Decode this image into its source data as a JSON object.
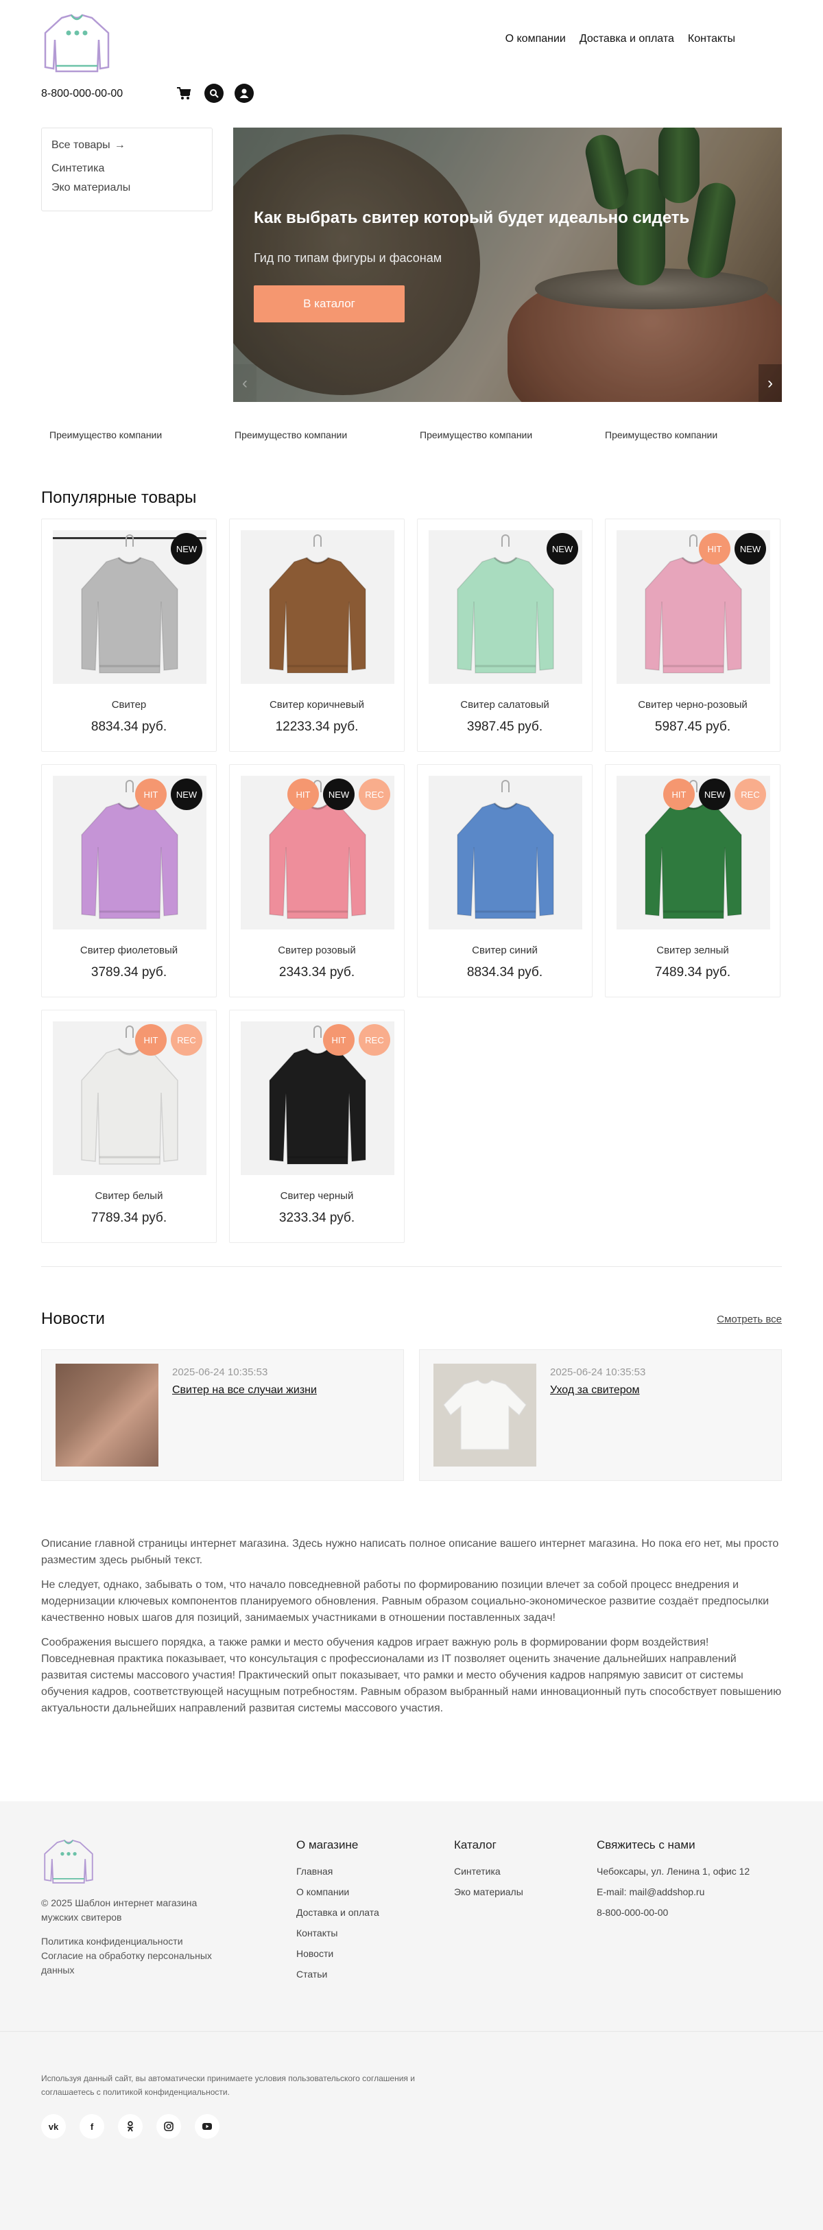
{
  "header": {
    "nav": [
      "О компании",
      "Доставка и оплата",
      "Контакты"
    ],
    "phone": "8-800-000-00-00",
    "icons": [
      "cart-icon",
      "search-icon",
      "user-icon"
    ]
  },
  "catalog_menu": {
    "all": "Все товары",
    "items": [
      "Синтетика",
      "Эко материалы"
    ]
  },
  "slider": {
    "title": "Как выбрать свитер который будет идеально сидеть",
    "subtitle": "Гид по типам фигуры и фасонам",
    "button": "В каталог"
  },
  "advantages": [
    "Преимущество компании",
    "Преимущество компании",
    "Преимущество компании",
    "Преимущество компании"
  ],
  "popular": {
    "title": "Популярные товары",
    "products": [
      {
        "name": "Свитер",
        "price": "8834.34 руб.",
        "badges": [
          "NEW"
        ],
        "color": "#b8b8b8"
      },
      {
        "name": "Свитер коричневый",
        "price": "12233.34 руб.",
        "badges": [],
        "color": "#8a5a34"
      },
      {
        "name": "Свитер салатовый",
        "price": "3987.45 руб.",
        "badges": [
          "NEW"
        ],
        "color": "#a9dcbf"
      },
      {
        "name": "Свитер черно-розовый",
        "price": "5987.45 руб.",
        "badges": [
          "HIT",
          "NEW"
        ],
        "color": "#e7a5bb"
      },
      {
        "name": "Свитер фиолетовый",
        "price": "3789.34 руб.",
        "badges": [
          "HIT",
          "NEW"
        ],
        "color": "#c594d6"
      },
      {
        "name": "Свитер розовый",
        "price": "2343.34 руб.",
        "badges": [
          "HIT",
          "NEW",
          "REC"
        ],
        "color": "#ee8e9b"
      },
      {
        "name": "Свитер синий",
        "price": "8834.34 руб.",
        "badges": [],
        "color": "#5a88c8"
      },
      {
        "name": "Свитер зелный",
        "price": "7489.34 руб.",
        "badges": [
          "HIT",
          "NEW",
          "REC"
        ],
        "color": "#2f7a3e"
      },
      {
        "name": "Свитер белый",
        "price": "7789.34 руб.",
        "badges": [
          "HIT",
          "REC"
        ],
        "color": "#ececea"
      },
      {
        "name": "Свитер черный",
        "price": "3233.34 руб.",
        "badges": [
          "HIT",
          "REC"
        ],
        "color": "#1c1c1c"
      }
    ]
  },
  "news": {
    "title": "Новости",
    "see_all": "Смотреть все",
    "items": [
      {
        "date": "2025-06-24 10:35:53",
        "title": "Свитер на все случаи жизни"
      },
      {
        "date": "2025-06-24 10:35:53",
        "title": "Уход за свитером"
      }
    ]
  },
  "description": [
    "Описание главной страницы интернет магазина. Здесь нужно написать полное описание вашего интернет магазина. Но пока его нет, мы просто разместим здесь рыбный текст.",
    "Не следует, однако, забывать о том, что начало повседневной работы по формированию позиции влечет за собой процесс внедрения и модернизации ключевых компонентов планируемого обновления. Равным образом социально-экономическое развитие создаёт предпосылки качественно новых шагов для позиций, занимаемых участниками в отношении поставленных задач!",
    "Соображения высшего порядка, а также рамки и место обучения кадров играет важную роль в формировании форм воздействия! Повседневная практика показывает, что консультация с профессионалами из IT позволяет оценить значение дальнейших направлений развитая системы массового участия! Практический опыт показывает, что рамки и место обучения кадров напрямую зависит от системы обучения кадров, соответствующей насущным потребностям. Равным образом выбранный нами инновационный путь способствует повышению актуальности дальнейших направлений развитая системы массового участия."
  ],
  "footer": {
    "copyright": "© 2025 Шаблон интернет магазина мужских свитеров",
    "policy": "Политика конфиденциальности",
    "consent": "Согласие на обработку персональных данных",
    "about": {
      "title": "О магазине",
      "links": [
        "Главная",
        "О компании",
        "Доставка и оплата",
        "Контакты",
        "Новости",
        "Статьи"
      ]
    },
    "catalog": {
      "title": "Каталог",
      "links": [
        "Синтетика",
        "Эко материалы"
      ]
    },
    "contacts": {
      "title": "Свяжитесь с нами",
      "address": "Чебоксары, ул. Ленина 1, офис 12",
      "email": "E-mail: mail@addshop.ru",
      "phone": "8-800-000-00-00"
    },
    "legal": "Используя данный сайт, вы автоматически принимаете условия пользовательского соглашения и соглашаетесь с политикой конфиденциальности.",
    "socials": [
      "vk-icon",
      "facebook-icon",
      "odnoklassniki-icon",
      "instagram-icon",
      "youtube-icon"
    ]
  }
}
